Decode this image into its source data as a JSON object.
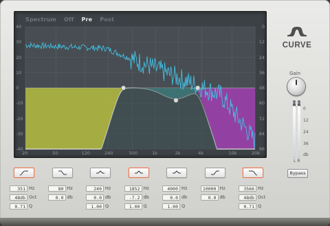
{
  "display": {
    "modes": [
      "Spectrum",
      "Off",
      "Pre",
      "Post"
    ],
    "active_mode": "Pre",
    "left_axis": [
      "40",
      "30",
      "20",
      "10",
      "0",
      "-10",
      "-20",
      "-30",
      "-40"
    ],
    "right_axis": [
      "0",
      "12",
      "24",
      "36",
      "48",
      "60",
      "72",
      "84",
      "96"
    ],
    "freq_axis": [
      "20",
      "50",
      "120",
      "240",
      "500",
      "1k",
      "2k",
      "4k",
      "10k",
      "20k"
    ]
  },
  "logo": {
    "text": "CURVE"
  },
  "gain": {
    "label": "Gain"
  },
  "meter": {
    "scale": [
      "0",
      "12",
      "24",
      "36",
      "db"
    ],
    "channels": "LR",
    "level_left": 0.95,
    "level_right": 0.95
  },
  "bypass": {
    "label": "Bypass"
  },
  "bands": [
    {
      "icon": "high-pass-icon",
      "active": true,
      "freq": "351",
      "freq_unit": "Hz",
      "slope": "48db",
      "slope_unit": "Oct",
      "q": "0.71",
      "q_unit": "Q"
    },
    {
      "icon": "low-shelf-icon",
      "active": false,
      "freq": "80",
      "freq_unit": "Hz",
      "gain": "0.0",
      "gain_unit": "db"
    },
    {
      "icon": "bell-icon",
      "active": false,
      "freq": "240",
      "freq_unit": "Hz",
      "gain": "0.0",
      "gain_unit": "db",
      "q": "1.00",
      "q_unit": "Q"
    },
    {
      "icon": "bell-icon",
      "active": true,
      "freq": "1852",
      "freq_unit": "Hz",
      "gain": "-7.2",
      "gain_unit": "db",
      "q": "1.00",
      "q_unit": "Q"
    },
    {
      "icon": "bell-icon",
      "active": false,
      "freq": "4000",
      "freq_unit": "Hz",
      "gain": "0.0",
      "gain_unit": "db",
      "q": "1.00",
      "q_unit": "Q"
    },
    {
      "icon": "high-shelf-icon",
      "active": false,
      "freq": "10000",
      "freq_unit": "Hz",
      "gain": "0.0",
      "gain_unit": "db"
    },
    {
      "icon": "low-pass-icon",
      "active": true,
      "freq": "3566",
      "freq_unit": "Hz",
      "slope": "48db",
      "slope_unit": "Oct",
      "q": "0.71",
      "q_unit": "Q"
    }
  ],
  "colors": {
    "background": "#e4e4e2",
    "display_bg": "#3c4145",
    "band_lowcut": "#b5bd3f",
    "band_bell": "#43a8a8",
    "band_highcut": "#a040b0",
    "spectrum": "#46bde0",
    "curve": "#e0e0e0",
    "active_outline": "#d77a5c"
  }
}
